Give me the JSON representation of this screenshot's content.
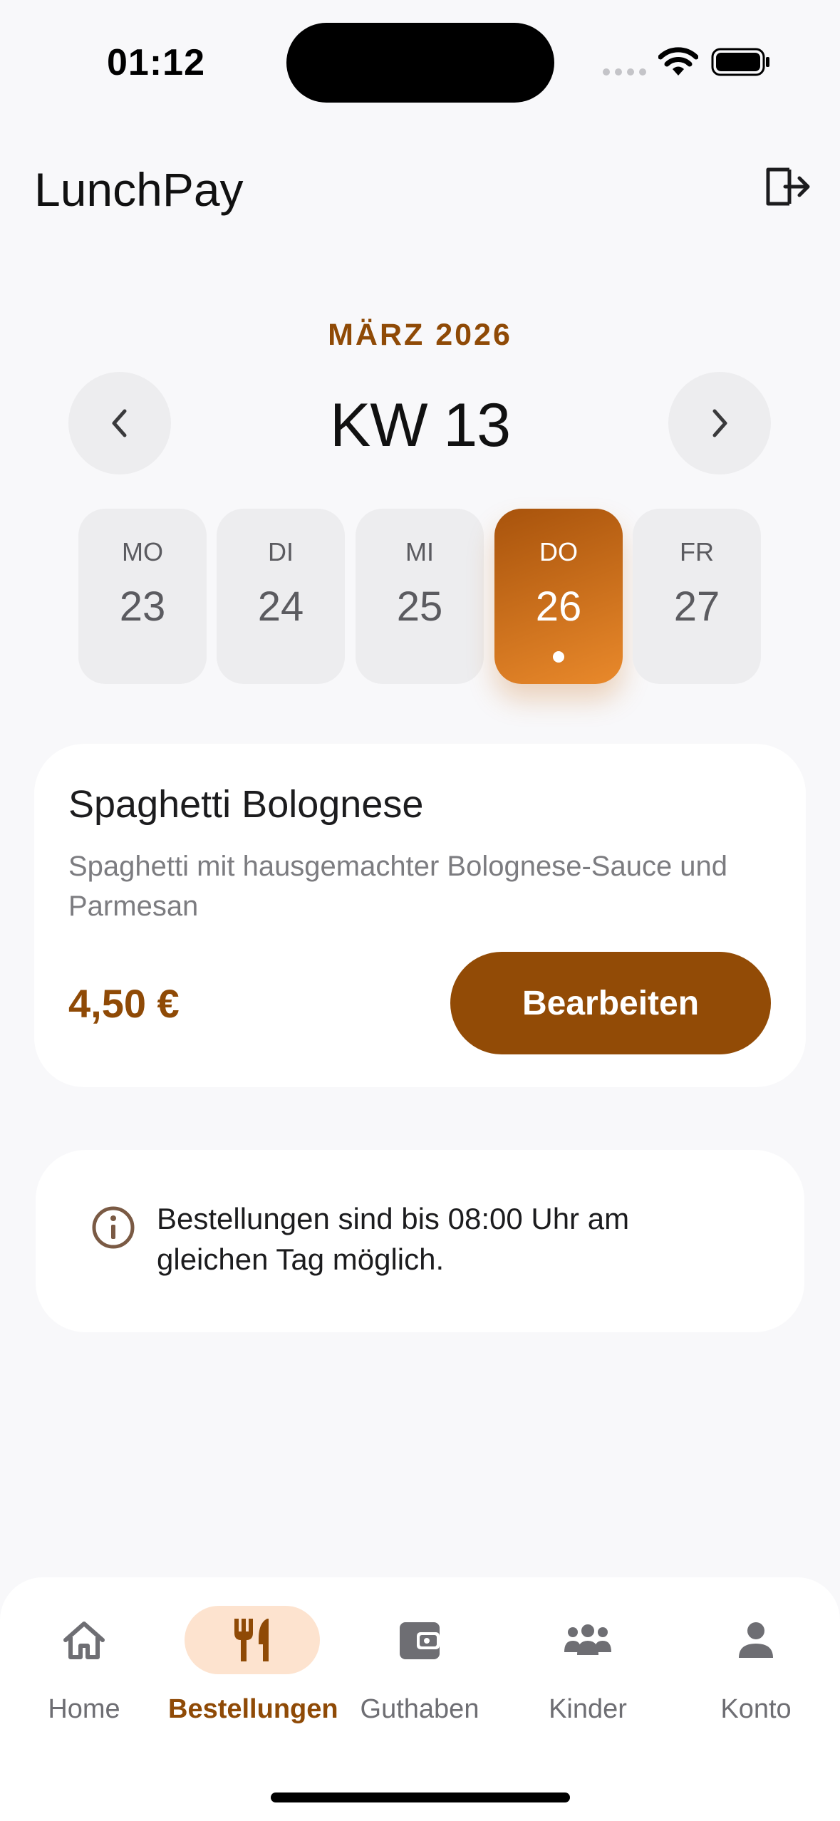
{
  "status_bar": {
    "time": "01:12"
  },
  "header": {
    "title": "LunchPay",
    "logout_icon": "logout-icon"
  },
  "calendar": {
    "month": "MÄRZ 2026",
    "week": "KW 13",
    "days": [
      {
        "name": "MO",
        "num": "23"
      },
      {
        "name": "DI",
        "num": "24"
      },
      {
        "name": "MI",
        "num": "25"
      },
      {
        "name": "DO",
        "num": "26",
        "selected": true
      },
      {
        "name": "FR",
        "num": "27"
      }
    ]
  },
  "meal": {
    "title": "Spaghetti Bolognese",
    "description": "Spaghetti mit hausgemachter Bolognese-Sauce und Parmesan",
    "price": "4,50 €",
    "edit_label": "Bearbeiten"
  },
  "info": {
    "text": "Bestellungen sind bis 08:00 Uhr am gleichen Tag möglich."
  },
  "tabs": [
    {
      "label": "Home",
      "icon": "home-icon"
    },
    {
      "label": "Bestellungen",
      "icon": "cutlery-icon",
      "active": true
    },
    {
      "label": "Guthaben",
      "icon": "wallet-icon"
    },
    {
      "label": "Kinder",
      "icon": "group-icon"
    },
    {
      "label": "Konto",
      "icon": "person-icon"
    }
  ],
  "colors": {
    "accent": "#924b06",
    "accent_light": "#fde3cf",
    "selected_gradient_start": "#a8530c",
    "selected_gradient_end": "#e9892b",
    "background": "#f8f8fa"
  }
}
